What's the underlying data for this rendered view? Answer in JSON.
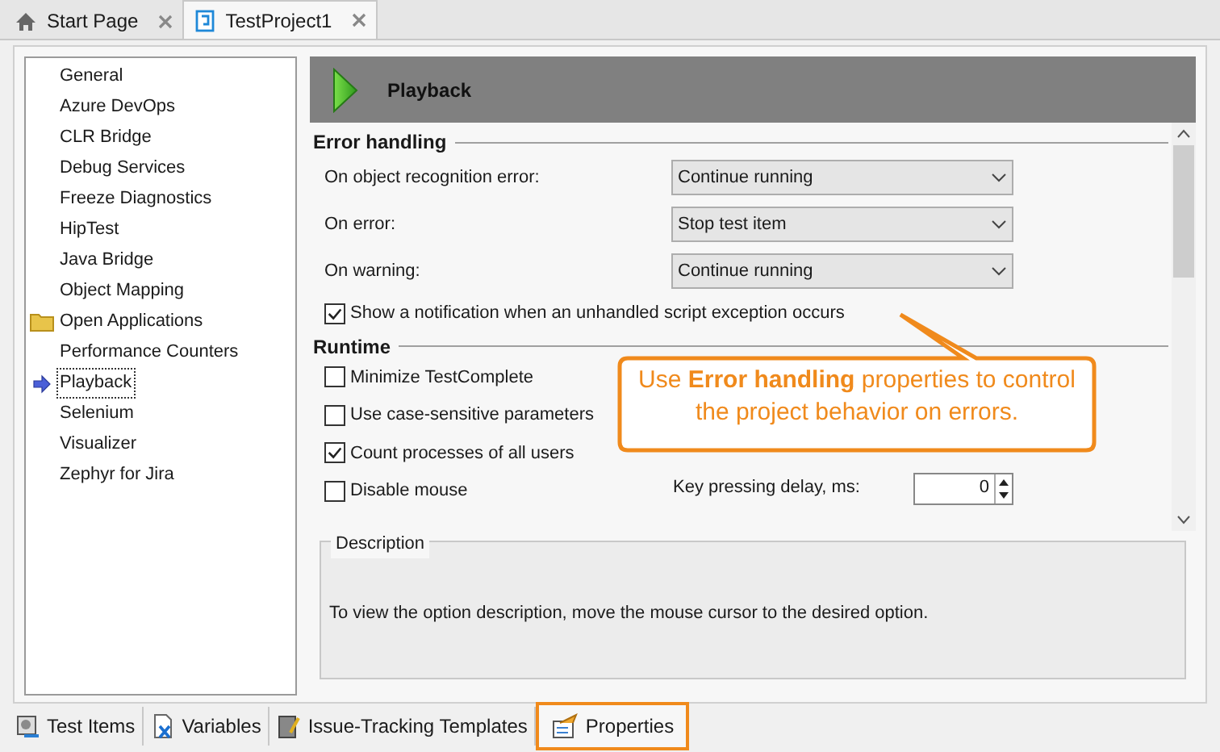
{
  "doc_tabs": [
    {
      "label": "Start Page",
      "selected": false
    },
    {
      "label": "TestProject1",
      "selected": true
    }
  ],
  "sidebar": {
    "items": [
      {
        "label": "General",
        "kind": "page",
        "selected": false
      },
      {
        "label": "Azure DevOps",
        "kind": "page",
        "selected": false
      },
      {
        "label": "CLR Bridge",
        "kind": "page",
        "selected": false
      },
      {
        "label": "Debug Services",
        "kind": "page",
        "selected": false
      },
      {
        "label": "Freeze Diagnostics",
        "kind": "page",
        "selected": false
      },
      {
        "label": "HipTest",
        "kind": "page",
        "selected": false
      },
      {
        "label": "Java Bridge",
        "kind": "page",
        "selected": false
      },
      {
        "label": "Object Mapping",
        "kind": "page",
        "selected": false
      },
      {
        "label": "Open Applications",
        "kind": "folder",
        "selected": false
      },
      {
        "label": "Performance Counters",
        "kind": "page",
        "selected": false
      },
      {
        "label": "Playback",
        "kind": "page",
        "selected": true
      },
      {
        "label": "Selenium",
        "kind": "page",
        "selected": false
      },
      {
        "label": "Visualizer",
        "kind": "page",
        "selected": false
      },
      {
        "label": "Zephyr for Jira",
        "kind": "page",
        "selected": false
      }
    ]
  },
  "header": {
    "title": "Playback"
  },
  "error_handling": {
    "title": "Error handling",
    "rows": [
      {
        "label": "On object recognition error:",
        "value": "Continue running"
      },
      {
        "label": "On error:",
        "value": "Stop test item"
      },
      {
        "label": "On warning:",
        "value": "Continue running"
      }
    ],
    "notify": {
      "label": "Show a notification when an unhandled script exception occurs",
      "checked": true
    }
  },
  "runtime": {
    "title": "Runtime",
    "options": [
      {
        "label": "Minimize TestComplete",
        "checked": false
      },
      {
        "label": "Use case-sensitive parameters",
        "checked": false
      },
      {
        "label": "Count processes of all users",
        "checked": true
      },
      {
        "label": "Disable mouse",
        "checked": false
      }
    ],
    "spinner": {
      "label": "Key pressing delay, ms:",
      "value": "0"
    }
  },
  "callout": {
    "text": "Use **Error handling** properties to control the project behavior on errors."
  },
  "description": {
    "title": "Description",
    "text": "To view the option description, move the mouse cursor to the desired option."
  },
  "bottom_tabs": [
    {
      "label": "Test Items",
      "selected": false
    },
    {
      "label": "Variables",
      "selected": false
    },
    {
      "label": "Issue-Tracking Templates",
      "selected": false
    },
    {
      "label": "Properties",
      "selected": true
    }
  ]
}
